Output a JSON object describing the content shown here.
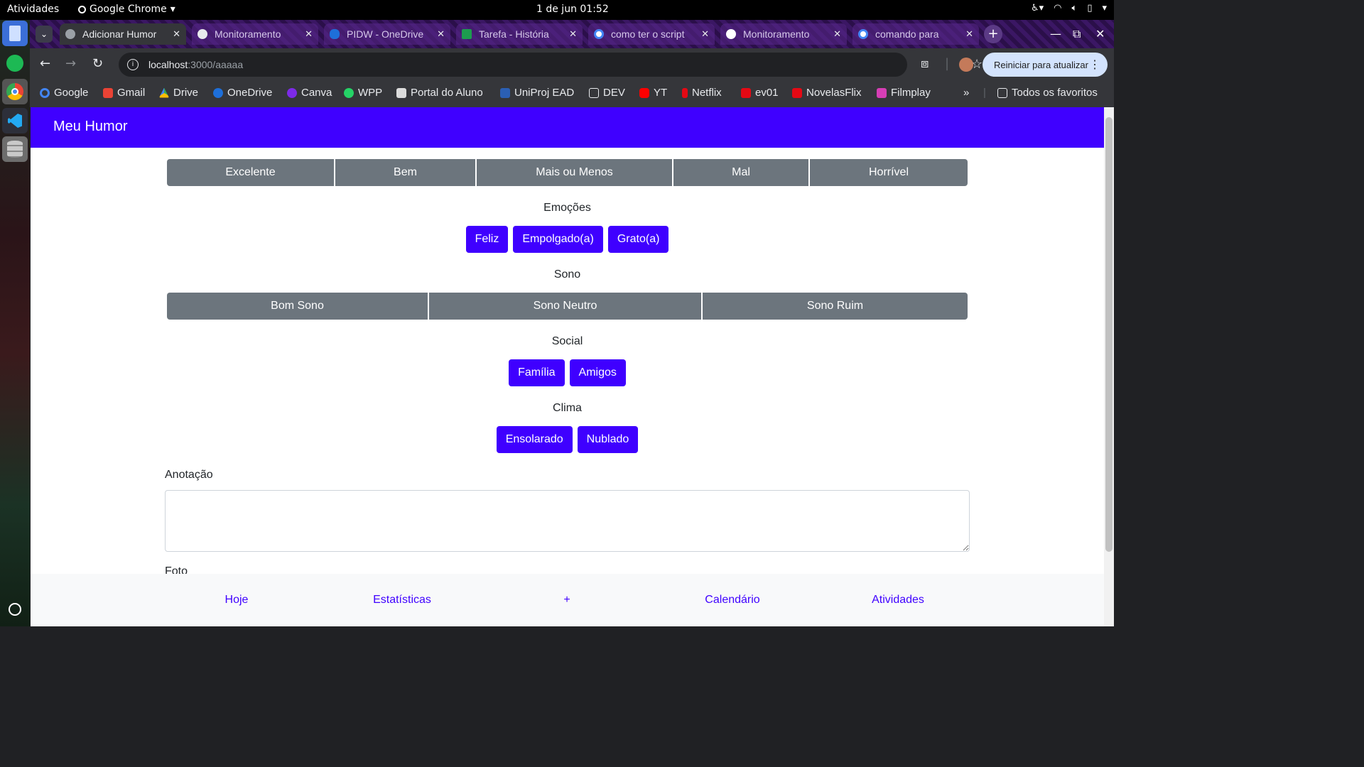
{
  "system_bar": {
    "activities": "Atividades",
    "app_name": "Google Chrome",
    "clock": "1 de jun  01:52"
  },
  "tabs": [
    {
      "title": "Adicionar Humor",
      "active": true,
      "favicon_color": "#9aa0a6"
    },
    {
      "title": "Monitoramento",
      "active": false,
      "favicon_color": "#e8eaed"
    },
    {
      "title": "PIDW - OneDrive",
      "active": false,
      "favicon_color": "#1e6fd9"
    },
    {
      "title": "Tarefa - História",
      "active": false,
      "favicon_color": "#1d9c4f"
    },
    {
      "title": "como ter o script",
      "active": false,
      "favicon_color": "#ffffff"
    },
    {
      "title": "Monitoramento",
      "active": false,
      "favicon_color": "#ffffff"
    },
    {
      "title": "comando para",
      "active": false,
      "favicon_color": "#ffffff"
    }
  ],
  "address_bar": {
    "host": "localhost",
    "path": ":3000/aaaaa"
  },
  "update_button": "Reiniciar para atualizar",
  "bookmarks": [
    {
      "label": "Google",
      "icon_color": "#4285f4"
    },
    {
      "label": "Gmail",
      "icon_color": "#ea4335"
    },
    {
      "label": "Drive",
      "icon_color": "#fbbc04"
    },
    {
      "label": "OneDrive",
      "icon_color": "#1e6fd9"
    },
    {
      "label": "Canva",
      "icon_color": "#7d2ae8"
    },
    {
      "label": "WPP",
      "icon_color": "#25d366"
    },
    {
      "label": "Portal do Aluno",
      "icon_color": "#dcdcdc"
    },
    {
      "label": "UniProj EAD",
      "icon_color": "#2b5fb4"
    },
    {
      "label": "DEV",
      "icon_color": "folder"
    },
    {
      "label": "YT",
      "icon_color": "#ff0000"
    },
    {
      "label": "Netflix",
      "icon_color": "#e50914"
    },
    {
      "label": "ev01",
      "icon_color": "#e50914"
    },
    {
      "label": "NovelasFlix",
      "icon_color": "#e50914"
    },
    {
      "label": "Filmplay",
      "icon_color": "#d63eb5"
    }
  ],
  "all_bookmarks": "Todos os favoritos",
  "app": {
    "brand": "Meu Humor",
    "moods": [
      "Excelente",
      "Bem",
      "Mais ou Menos",
      "Mal",
      "Horrível"
    ],
    "emotions_label": "Emoções",
    "emotions": [
      "Feliz",
      "Empolgado(a)",
      "Grato(a)"
    ],
    "sleep_label": "Sono",
    "sleep": [
      "Bom Sono",
      "Sono Neutro",
      "Sono Ruim"
    ],
    "social_label": "Social",
    "social": [
      "Família",
      "Amigos"
    ],
    "weather_label": "Clima",
    "weather": [
      "Ensolarado",
      "Nublado"
    ],
    "note_label": "Anotação",
    "photo_label": "Foto",
    "bottom_nav": [
      "Hoje",
      "Estatísticas",
      "+",
      "Calendário",
      "Atividades"
    ]
  },
  "colors": {
    "primary": "#3f00ff",
    "secondary": "#6c757d"
  }
}
